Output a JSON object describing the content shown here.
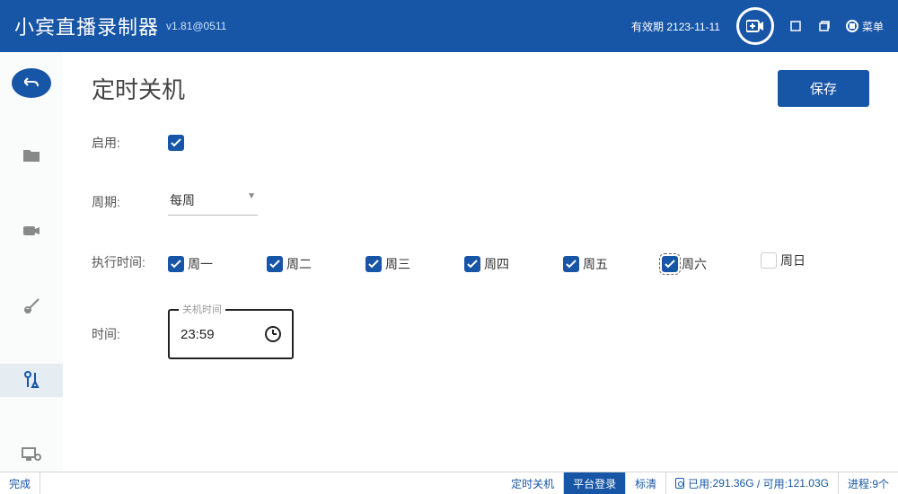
{
  "header": {
    "title": "小宾直播录制器",
    "version": "v1.81@0511",
    "expiry_prefix": "有效期",
    "expiry_date": "2123-11-11",
    "menu_label": "菜单"
  },
  "page": {
    "title": "定时关机",
    "save_label": "保存"
  },
  "form": {
    "enable_label": "启用:",
    "enable_checked": true,
    "cycle_label": "周期:",
    "cycle_value": "每周",
    "exec_label": "执行时间:",
    "days": [
      {
        "label": "周一",
        "checked": true
      },
      {
        "label": "周二",
        "checked": true
      },
      {
        "label": "周三",
        "checked": true
      },
      {
        "label": "周四",
        "checked": true
      },
      {
        "label": "周五",
        "checked": true
      },
      {
        "label": "周六",
        "checked": true
      },
      {
        "label": "周日",
        "checked": false
      }
    ],
    "time_label": "时间:",
    "time_caption": "关机时间",
    "time_value": "23:59"
  },
  "footer": {
    "status": "完成",
    "tab1": "定时关机",
    "tab2": "平台登录",
    "tab3": "标清",
    "disk_used_label": "已用:",
    "disk_used": "291.36G",
    "disk_avail_label": "/ 可用:",
    "disk_avail": "121.03G",
    "proc_label": "进程:",
    "proc_count": "9个"
  }
}
